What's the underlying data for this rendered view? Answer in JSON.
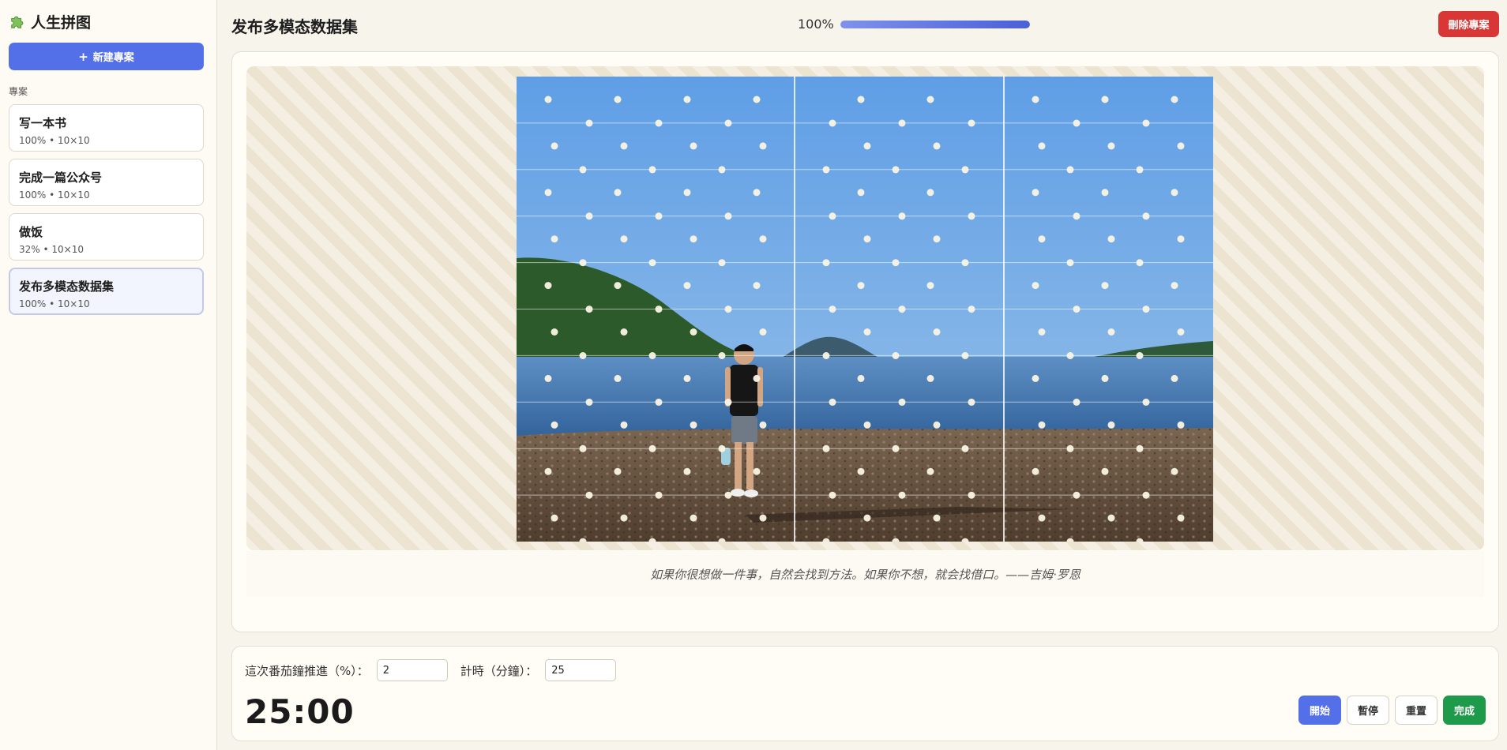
{
  "sidebar": {
    "brand": "人生拼图",
    "new_project_label": "新建專案",
    "section_label": "專案",
    "projects": [
      {
        "name": "写一本书",
        "meta": "100%  •  10×10"
      },
      {
        "name": "完成一篇公众号",
        "meta": "100%  •  10×10"
      },
      {
        "name": "做饭",
        "meta": "32%  •  10×10"
      },
      {
        "name": "发布多模态数据集",
        "meta": "100%  •  10×10",
        "active": true
      }
    ]
  },
  "header": {
    "title": "发布多模态数据集",
    "progress_text": "100%",
    "progress_value": 100,
    "delete_label": "刪除專案"
  },
  "board": {
    "quote": "如果你很想做一件事，自然会找到方法。如果你不想，就会找借口。——吉姆·罗恩"
  },
  "timer": {
    "advance_label": "這次番茄鐘推進（%）：",
    "advance_value": "2",
    "minutes_label": "計時（分鐘）：",
    "minutes_value": "25",
    "display": "25:00",
    "start_label": "開始",
    "pause_label": "暫停",
    "reset_label": "重置",
    "done_label": "完成"
  },
  "colors": {
    "accent": "#5470e8",
    "danger": "#d93636",
    "success": "#1e9b4a"
  }
}
